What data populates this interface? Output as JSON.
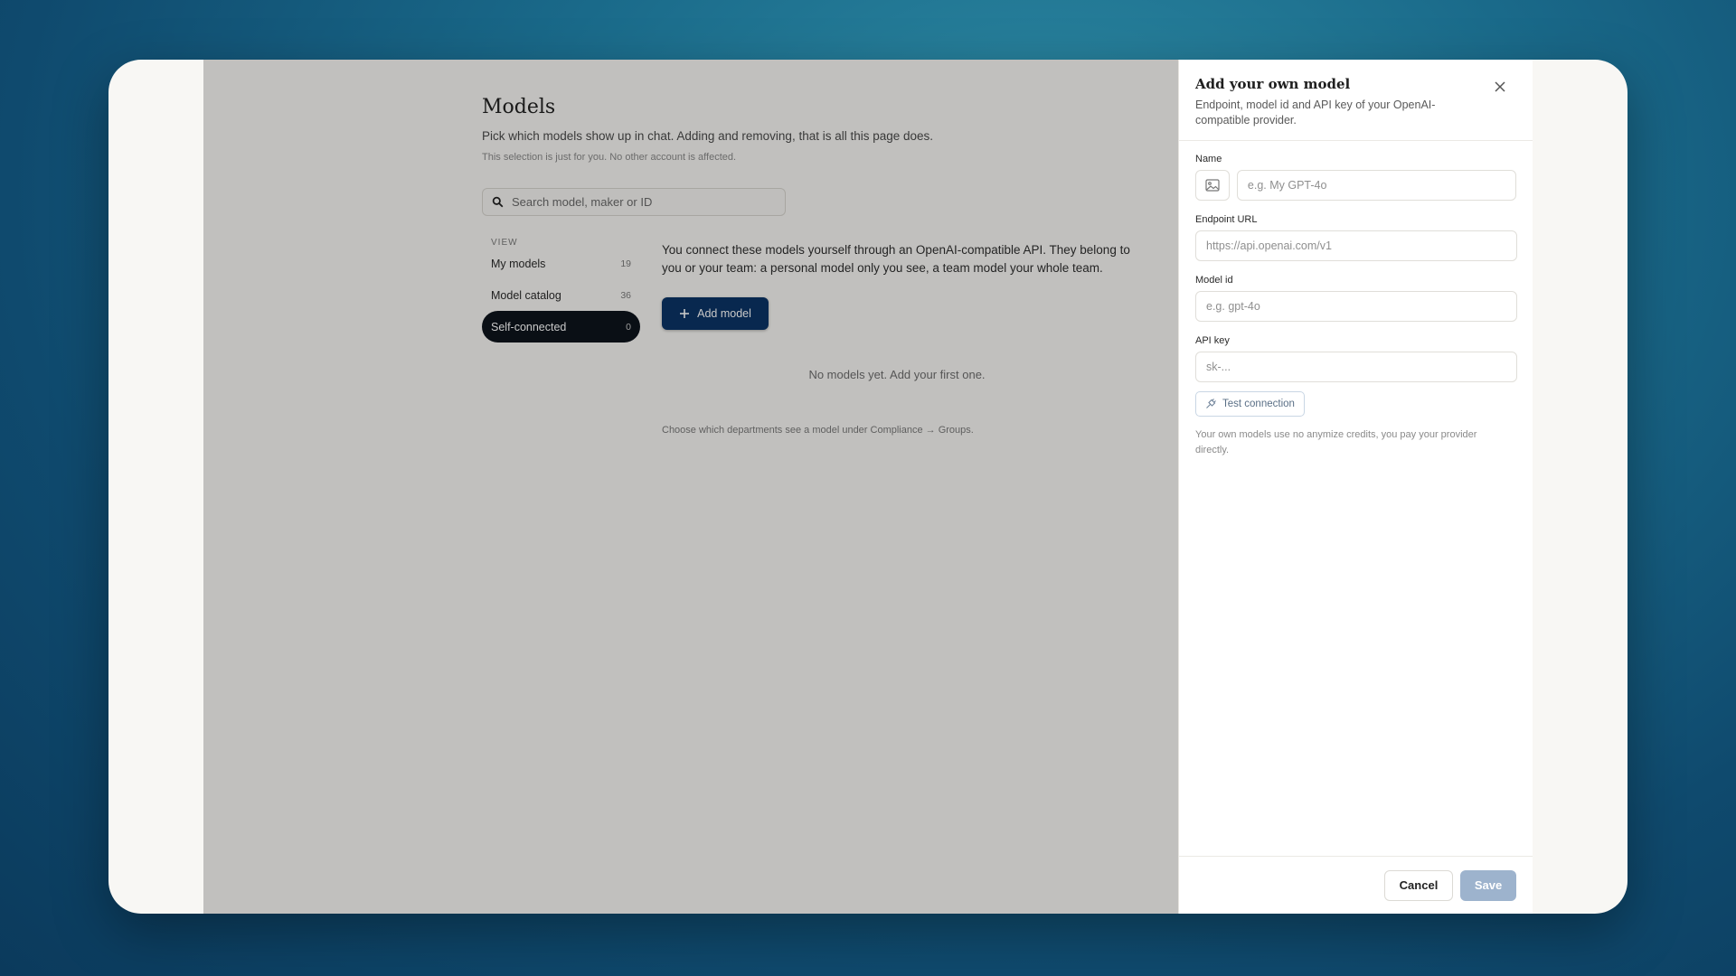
{
  "page": {
    "title": "Models",
    "subtitle": "Pick which models show up in chat. Adding and removing, that is all this page does.",
    "note": "This selection is just for you. No other account is affected.",
    "search_placeholder": "Search model, maker or ID"
  },
  "sidebar": {
    "view_label": "VIEW",
    "items": [
      {
        "label": "My models",
        "count": "19"
      },
      {
        "label": "Model catalog",
        "count": "36"
      },
      {
        "label": "Self-connected",
        "count": "0"
      }
    ]
  },
  "content": {
    "description": "You connect these models yourself through an OpenAI-compatible API. They belong to you or your team: a personal model only you see, a team model your whole team.",
    "add_button_label": "Add model",
    "empty_text": "No models yet. Add your first one.",
    "footer_note": "Choose which departments see a model under Compliance → Groups."
  },
  "panel": {
    "title": "Add your own model",
    "subtitle": "Endpoint, model id and API key of your OpenAI-compatible provider.",
    "fields": {
      "name_label": "Name",
      "name_placeholder": "e.g. My GPT-4o",
      "endpoint_label": "Endpoint URL",
      "endpoint_placeholder": "https://api.openai.com/v1",
      "model_id_label": "Model id",
      "model_id_placeholder": "e.g. gpt-4o",
      "api_key_label": "API key",
      "api_key_placeholder": "sk-..."
    },
    "test_button_label": "Test connection",
    "credit_note": "Your own models use no anymize credits, you pay your provider directly.",
    "cancel_label": "Cancel",
    "save_label": "Save"
  },
  "colors": {
    "accent": "#0b3466",
    "active_nav": "#0e141c",
    "save_disabled": "#9db3cd"
  }
}
